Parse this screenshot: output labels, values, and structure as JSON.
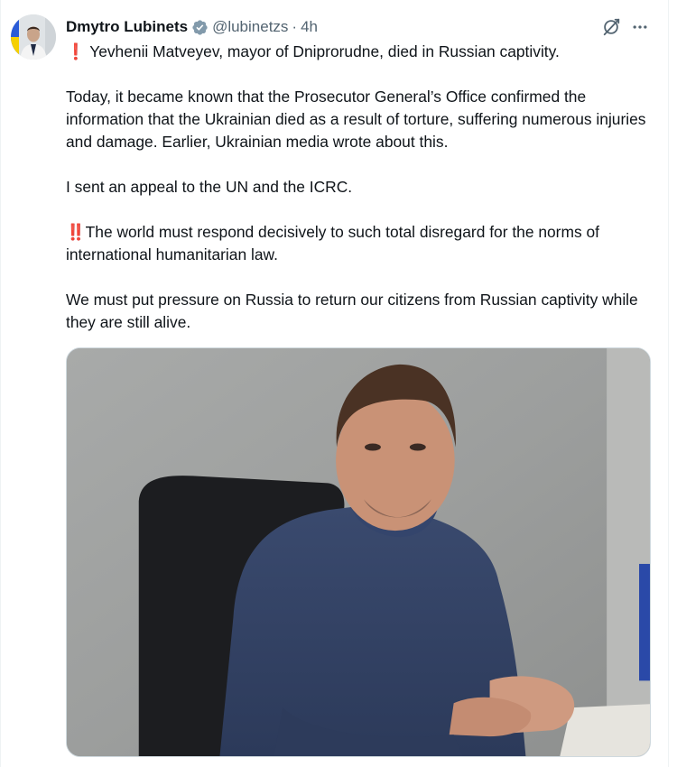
{
  "author": {
    "display_name": "Dmytro Lubinets",
    "handle": "@lubinetzs",
    "separator": "·",
    "time": "4h"
  },
  "icons": {
    "verified": "verified-badge-icon",
    "grok": "grok-icon",
    "more": "more-options-icon",
    "exclamation": "red-exclamation-icon",
    "double_exclamation": "red-double-exclamation-icon"
  },
  "colors": {
    "text": "#0f1419",
    "secondary": "#536471",
    "verified": "#829aab",
    "alert": "#d0021b",
    "border": "#cfd9de"
  },
  "tweet": {
    "p1": "Yevhenii Matveyev, mayor of Dniprorudne, died in Russian captivity.",
    "p2": "Today, it became known that the Prosecutor General’s Office confirmed the information that the Ukrainian died as a result of torture, suffering numerous injuries and damage. Earlier, Ukrainian media wrote about this.",
    "p3": "I sent an appeal to the UN and the ICRC.",
    "p4": "The world must respond decisively to such total disregard for the norms of international humanitarian law.",
    "p5": "We must put pressure on Russia to return our citizens from Russian captivity while they are still alive."
  }
}
